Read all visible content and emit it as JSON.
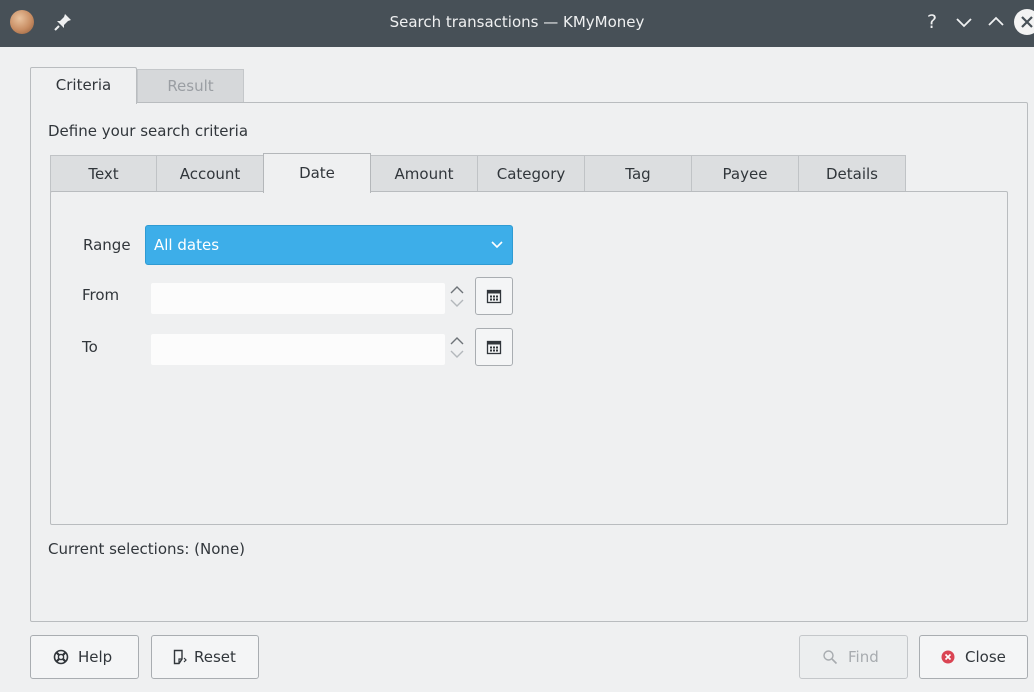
{
  "window": {
    "title": "Search transactions — KMyMoney",
    "help_glyph": "?"
  },
  "outer_tabs": [
    {
      "label": "Criteria"
    },
    {
      "label": "Result"
    }
  ],
  "criteria": {
    "heading": "Define your search criteria",
    "inner_tabs": [
      {
        "label": "Text"
      },
      {
        "label": "Account"
      },
      {
        "label": "Date"
      },
      {
        "label": "Amount"
      },
      {
        "label": "Category"
      },
      {
        "label": "Tag"
      },
      {
        "label": "Payee"
      },
      {
        "label": "Details"
      }
    ],
    "active_inner_tab": "Date",
    "date": {
      "range_label": "Range",
      "range_value": "All dates",
      "from_label": "From",
      "from_value": "",
      "to_label": "To",
      "to_value": ""
    },
    "current_selections": "Current selections: (None)"
  },
  "buttons": {
    "help": "Help",
    "reset": "Reset",
    "find": "Find",
    "close": "Close"
  },
  "colors": {
    "accent": "#3daee9",
    "titlebar": "#475057",
    "close_icon": "#da4453"
  }
}
